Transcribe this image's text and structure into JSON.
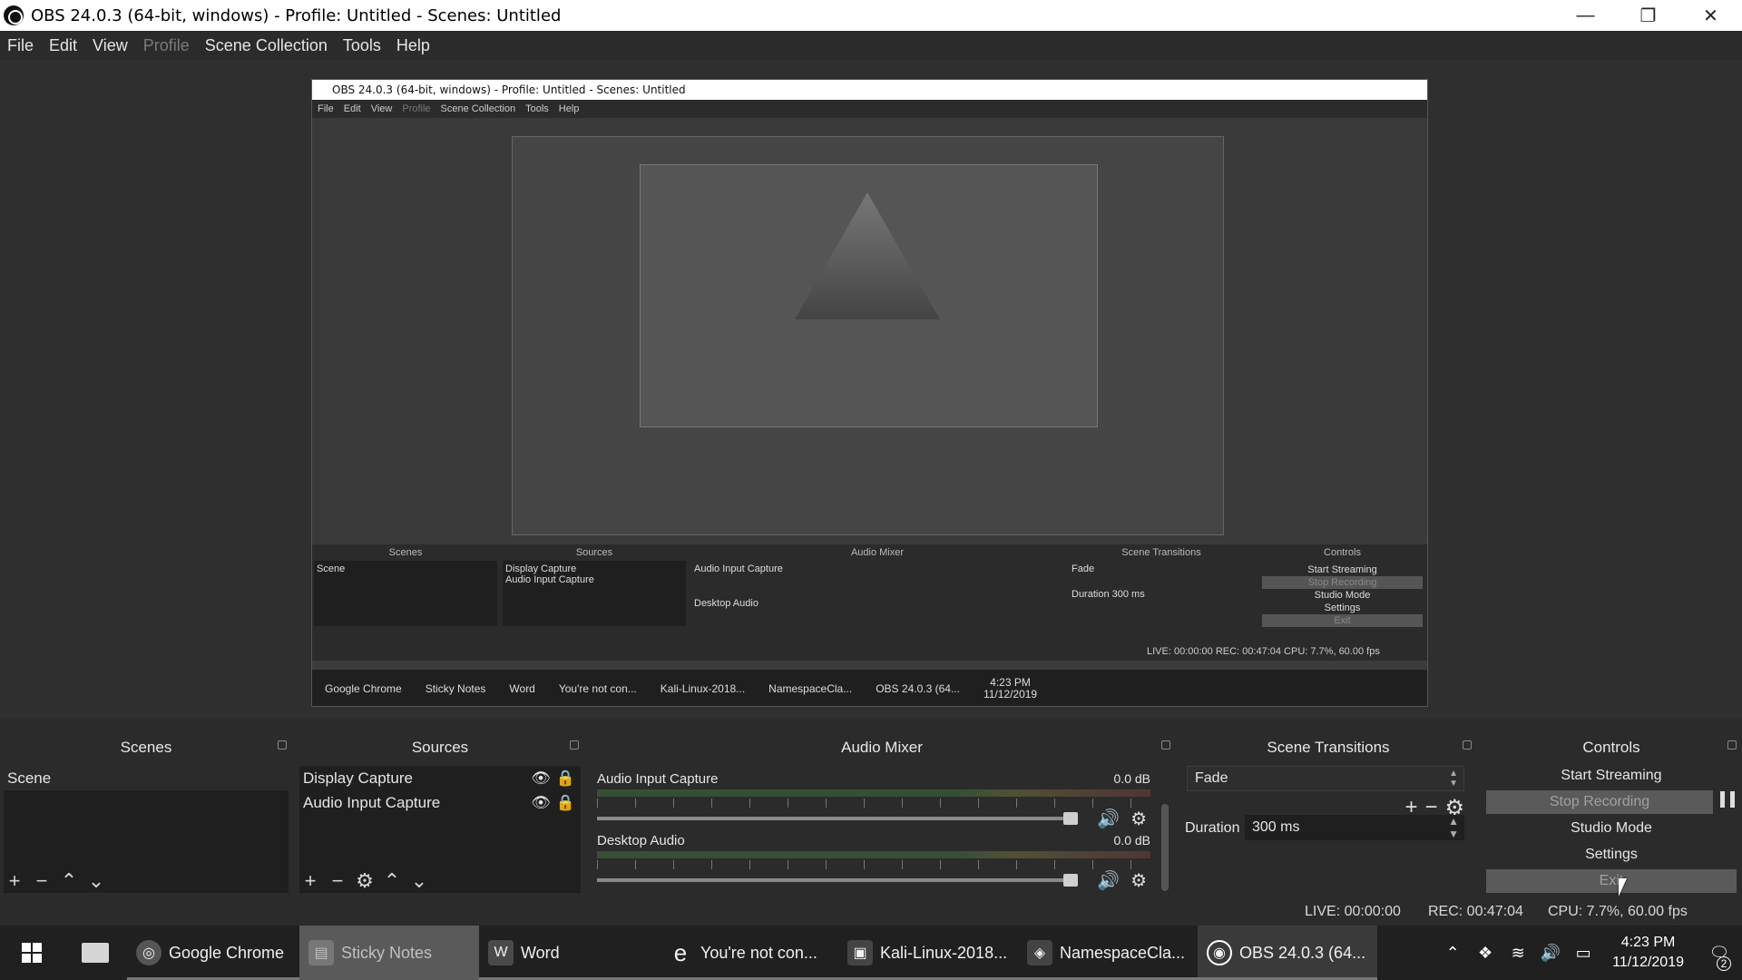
{
  "window": {
    "title": "OBS 24.0.3 (64-bit, windows) - Profile: Untitled - Scenes: Untitled",
    "minimize": "—",
    "maximize": "❐",
    "close": "✕"
  },
  "menu": {
    "file": "File",
    "edit": "Edit",
    "view": "View",
    "profile": "Profile",
    "scene_collection": "Scene Collection",
    "tools": "Tools",
    "help": "Help"
  },
  "nested": {
    "title": "OBS 24.0.3 (64-bit, windows) - Profile: Untitled - Scenes: Untitled",
    "menu": [
      "File",
      "Edit",
      "View",
      "Profile",
      "Scene Collection",
      "Tools",
      "Help"
    ],
    "docks": {
      "scenes": "Scenes",
      "sources": "Sources",
      "mixer": "Audio Mixer",
      "transitions": "Scene Transitions",
      "controls": "Controls",
      "scene_item": "Scene",
      "source_items": [
        "Display Capture",
        "Audio Input Capture"
      ],
      "mixer_items": [
        "Audio Input Capture",
        "Desktop Audio"
      ],
      "fade": "Fade",
      "duration": "Duration",
      "duration_value": "300 ms",
      "controls_items": [
        "Start Streaming",
        "Stop Recording",
        "Studio Mode",
        "Settings",
        "Exit"
      ]
    },
    "status": "LIVE: 00:00:00   REC: 00:47:04   CPU: 7.7%, 60.00 fps",
    "taskbar": [
      "Google Chrome",
      "Sticky Notes",
      "Word",
      "You're not con...",
      "Kali-Linux-2018...",
      "NamespaceCla...",
      "OBS 24.0.3 (64...",
      "4:23 PM",
      "11/12/2019"
    ]
  },
  "scenes": {
    "header": "Scenes",
    "items": [
      "Scene"
    ]
  },
  "sources": {
    "header": "Sources",
    "items": [
      "Display Capture",
      "Audio Input Capture"
    ]
  },
  "mixer": {
    "header": "Audio Mixer",
    "channels": [
      {
        "name": "Audio Input Capture",
        "db": "0.0 dB"
      },
      {
        "name": "Desktop Audio",
        "db": "0.0 dB"
      }
    ]
  },
  "transitions": {
    "header": "Scene Transitions",
    "selected": "Fade",
    "duration_label": "Duration",
    "duration_value": "300 ms"
  },
  "controls": {
    "header": "Controls",
    "start_streaming": "Start Streaming",
    "stop_recording": "Stop Recording",
    "studio_mode": "Studio Mode",
    "settings": "Settings",
    "exit": "Exit"
  },
  "status": {
    "live": "LIVE: 00:00:00",
    "rec": "REC: 00:47:04",
    "cpu": "CPU: 7.7%, 60.00 fps"
  },
  "taskbar": {
    "apps": [
      {
        "label": "Google Chrome",
        "icon": "chrome-icon"
      },
      {
        "label": "Sticky Notes",
        "icon": "sticky-notes-icon"
      },
      {
        "label": "Word",
        "icon": "word-icon"
      },
      {
        "label": "You're not con...",
        "icon": "edge-icon"
      },
      {
        "label": "Kali-Linux-2018...",
        "icon": "vm-icon"
      },
      {
        "label": "NamespaceCla...",
        "icon": "vs-icon"
      },
      {
        "label": "OBS 24.0.3 (64...",
        "icon": "obs-icon"
      }
    ],
    "time": "4:23 PM",
    "date": "11/12/2019",
    "notifications": "2"
  }
}
